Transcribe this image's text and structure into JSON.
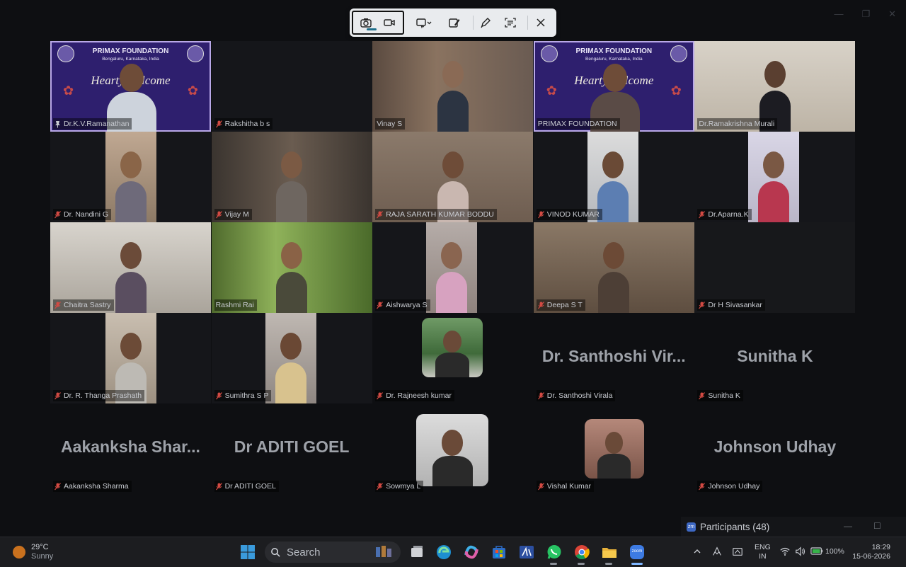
{
  "window": {
    "minimize": "—",
    "maximize": "❐",
    "close": "✕"
  },
  "snip_toolbar": {
    "tools": [
      "camera-mode",
      "video-mode",
      "rectangle-snip",
      "edit",
      "pen",
      "text-actions",
      "close"
    ]
  },
  "gallery": {
    "tiles": [
      {
        "name": "Dr.K.V.Ramanathan",
        "type": "banner",
        "banner_title": "PRIMAX FOUNDATION",
        "banner_sub": "Bengaluru, Karnataka, India",
        "banner_text": "Hearty Welcome You",
        "active": true,
        "pinned": true,
        "muted": false
      },
      {
        "name": "Rakshitha b s",
        "type": "video",
        "muted": true
      },
      {
        "name": "Vinay S",
        "type": "video",
        "muted": false
      },
      {
        "name": "PRIMAX FOUNDATION",
        "type": "banner",
        "banner_title": "PRIMAX FOUNDATION",
        "banner_sub": "Bengaluru, Karnataka, India",
        "banner_text": "Hearty Welcome You",
        "muted": false
      },
      {
        "name": "Dr.Ramakrishna Murali",
        "type": "video",
        "muted": false
      },
      {
        "name": "Dr. Nandini G",
        "type": "video",
        "muted": true
      },
      {
        "name": "Vijay M",
        "type": "video",
        "muted": true
      },
      {
        "name": "RAJA SARATH KUMAR BODDU",
        "type": "video",
        "muted": true
      },
      {
        "name": "VINOD KUMAR",
        "type": "video",
        "muted": true
      },
      {
        "name": "Dr.Aparna.K",
        "type": "video",
        "muted": true
      },
      {
        "name": "Chaitra Sastry",
        "type": "video",
        "muted": true
      },
      {
        "name": "Rashmi Rai",
        "type": "video",
        "muted": false
      },
      {
        "name": "Aishwarya S",
        "type": "video",
        "muted": true
      },
      {
        "name": "Deepa S T",
        "type": "video",
        "muted": true
      },
      {
        "name": "Dr H Sivasankar",
        "type": "empty",
        "muted": true
      },
      {
        "name": "Dr. R. Thanga Prashath",
        "type": "video",
        "muted": true
      },
      {
        "name": "Sumithra S P",
        "type": "video",
        "muted": true
      },
      {
        "name": "Dr. Rajneesh kumar",
        "type": "avatar",
        "muted": true
      },
      {
        "name": "Dr. Santhoshi Virala",
        "type": "name",
        "display": "Dr. Santhoshi Vir...",
        "muted": true
      },
      {
        "name": "Sunitha K",
        "type": "name",
        "display": "Sunitha K",
        "muted": true
      },
      {
        "name": "Aakanksha Sharma",
        "type": "name",
        "display": "Aakanksha Shar...",
        "muted": true
      },
      {
        "name": "Dr ADITI GOEL",
        "type": "name",
        "display": "Dr ADITI GOEL",
        "muted": true
      },
      {
        "name": "Sowmya L",
        "type": "avatar",
        "muted": true
      },
      {
        "name": "Vishal Kumar",
        "type": "avatar",
        "muted": true
      },
      {
        "name": "Johnson Udhay",
        "type": "name",
        "display": "Johnson Udhay",
        "muted": true
      }
    ]
  },
  "participants_panel": {
    "label": "Participants (48)",
    "zoom_badge": "zm"
  },
  "taskbar": {
    "weather": {
      "temp": "29°C",
      "condition": "Sunny"
    },
    "search_placeholder": "Search",
    "language": {
      "line1": "ENG",
      "line2": "IN"
    },
    "battery": "100%",
    "time": "18:29",
    "date": "15-06-2026",
    "zoom_app_label": "zoom"
  },
  "colors": {
    "active_speaker": "#2fb27a",
    "banner_bg": "#2e1f6e",
    "muted_mic": "#d24a43"
  }
}
